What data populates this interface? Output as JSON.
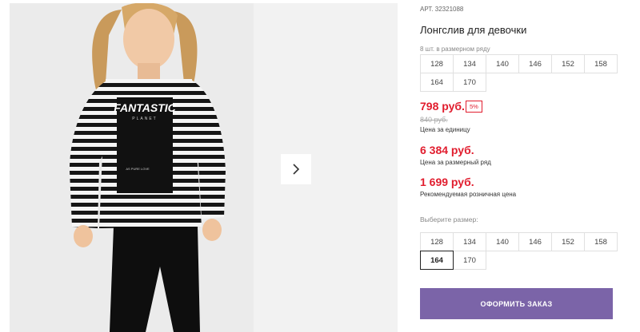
{
  "product": {
    "sku_label": "АРТ.",
    "sku_value": "32321088",
    "title": "Лонгслив для девочки",
    "row_info": "8 шт. в размерном ряду",
    "print_headline": "FANTASTIC",
    "print_sub": "PLANET",
    "print_small": "AS PURE LOVE"
  },
  "size_row": [
    "128",
    "134",
    "140",
    "146",
    "152",
    "158",
    "164",
    "170"
  ],
  "pricing": {
    "unit_price": "798 руб.",
    "discount_badge": "5%",
    "old_price": "840 руб.",
    "unit_note": "Цена за единицу",
    "set_price": "6 384 руб.",
    "set_note": "Цена за размерный ряд",
    "rrp_price": "1 699 руб.",
    "rrp_note": "Рекомендуемая розничная цена"
  },
  "size_picker": {
    "label": "Выберите размер:",
    "options": [
      "128",
      "134",
      "140",
      "146",
      "152",
      "158",
      "164",
      "170"
    ],
    "selected": "164"
  },
  "actions": {
    "order_label": "ОФОРМИТЬ ЗАКАЗ"
  },
  "icons": {
    "next": "chevron-right-icon"
  },
  "colors": {
    "price_red": "#e11d2e",
    "order_button": "#7b64a8"
  }
}
